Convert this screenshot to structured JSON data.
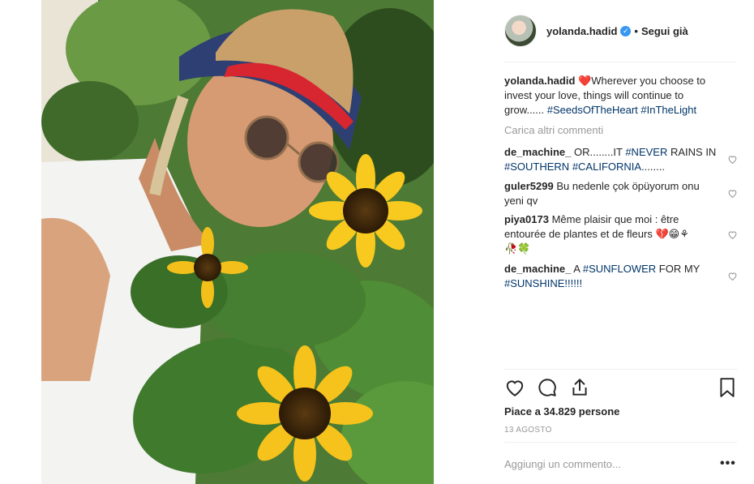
{
  "post": {
    "image_alt": "Selfie with sunflowers",
    "author": "yolanda.hadid",
    "verified": true,
    "follow_status": "Segui già"
  },
  "caption": {
    "username": "yolanda.hadid",
    "text": "Wherever you choose to invest your love, things will continue to grow...... ",
    "tags": [
      "#SeedsOfTheHeart",
      "#InTheLight"
    ]
  },
  "load_more": "Carica altri commenti",
  "comments": [
    {
      "username": "de_machine_",
      "parts": [
        "OR........IT ",
        "#NEVER",
        " RAINS IN ",
        "#SOUTHERN",
        " ",
        "#CALIFORNIA",
        "........"
      ]
    },
    {
      "username": "guler5299",
      "text": "Bu nedenle çok öpüyorum onu yeni qv"
    },
    {
      "username": "piya0173",
      "text": "Même plaisir que moi : être entourée de plantes et de fleurs 💔😁⚘",
      "line2": "🥀🍀"
    },
    {
      "username": "de_machine_",
      "parts": [
        "A ",
        "#SUNFLOWER",
        " FOR MY ",
        "#SUNSHINE!!!!!!"
      ]
    }
  ],
  "actions": {
    "like_icon": "heart-outline-icon",
    "comment_icon": "speech-bubble-icon",
    "share_icon": "share-upload-icon",
    "save_icon": "bookmark-icon"
  },
  "likes_text": "Piace a 34.829 persone",
  "date": "13 AGOSTO",
  "add_comment_placeholder": "Aggiungi un commento...",
  "more_label": "•••",
  "colors": {
    "link": "#003569",
    "muted": "#999999",
    "verified": "#3897f0",
    "heart": "#ed4956"
  }
}
